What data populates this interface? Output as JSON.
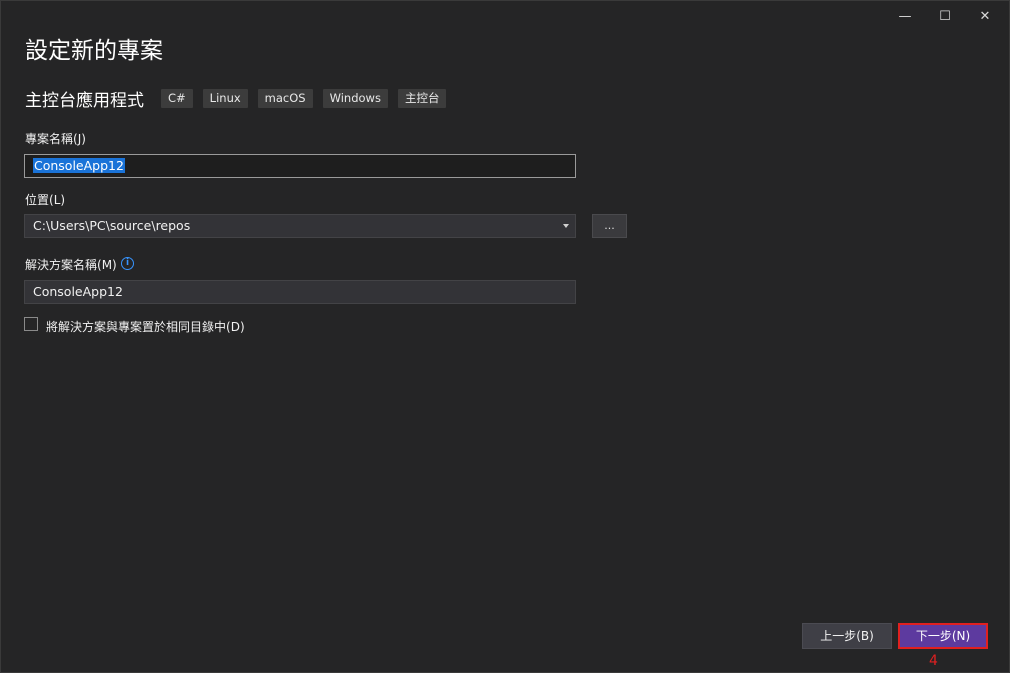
{
  "window": {
    "controls": {
      "minimize": "—",
      "maximize": "☐",
      "close": "✕"
    }
  },
  "page_title": "設定新的專案",
  "template": {
    "name": "主控台應用程式",
    "tags": [
      "C#",
      "Linux",
      "macOS",
      "Windows",
      "主控台"
    ]
  },
  "project_name": {
    "label": "專案名稱",
    "mnemonic": "(J)",
    "value": "ConsoleApp12"
  },
  "location": {
    "label": "位置",
    "mnemonic": "(L)",
    "value": "C:\\Users\\PC\\source\\repos",
    "browse_label": "..."
  },
  "solution_name": {
    "label": "解決方案名稱",
    "mnemonic": "(M)",
    "value": "ConsoleApp12",
    "info_icon": "info-icon"
  },
  "same_directory": {
    "label": "將解決方案與專案置於相同目錄中",
    "mnemonic": "(D)",
    "checked": false
  },
  "footer": {
    "back_label": "上一步(B)",
    "next_label": "下一步(N)",
    "annotation": "4"
  },
  "colors": {
    "background": "#252526",
    "accent": "#5d3a9f",
    "highlight": "#e02020",
    "selection": "#1a73d8",
    "info": "#3794ff"
  }
}
